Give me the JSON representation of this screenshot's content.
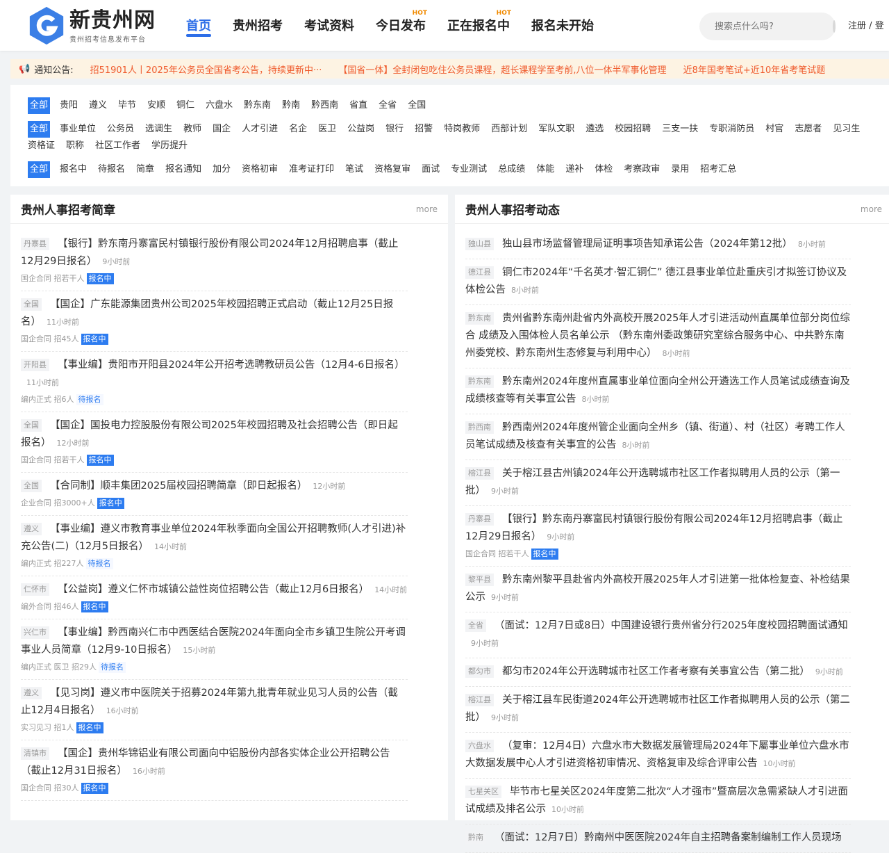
{
  "header": {
    "logo_name": "新贵州网",
    "logo_sub": "贵州招考信息发布平台",
    "nav": [
      {
        "label": "首页",
        "active": true
      },
      {
        "label": "贵州招考"
      },
      {
        "label": "考试资料"
      },
      {
        "label": "今日发布",
        "hot": "HOT"
      },
      {
        "label": "正在报名中",
        "hot": "HOT"
      },
      {
        "label": "报名未开始"
      }
    ],
    "search_placeholder": "搜索点什么吗?",
    "register": "注册",
    "separator": "/",
    "login": "登"
  },
  "notice": {
    "label": "通知公告:",
    "messages": [
      "招51901人丨2025年公务员全国省考公告，持续更新中···",
      "【国省一体】全封闭包吃住公务员课程，超长课程学至考前,八位一体半军事化管理",
      "近8年国考笔试+近10年省考笔试题"
    ]
  },
  "filters": [
    [
      "全部",
      "贵阳",
      "遵义",
      "毕节",
      "安顺",
      "铜仁",
      "六盘水",
      "黔东南",
      "黔南",
      "黔西南",
      "省直",
      "全省",
      "全国"
    ],
    [
      "全部",
      "事业单位",
      "公务员",
      "选调生",
      "教师",
      "国企",
      "人才引进",
      "名企",
      "医卫",
      "公益岗",
      "银行",
      "招警",
      "特岗教师",
      "西部计划",
      "军队文职",
      "遴选",
      "校园招聘",
      "三支一扶",
      "专职消防员",
      "村官",
      "志愿者",
      "见习生",
      "资格证",
      "职称",
      "社区工作者",
      "学历提升"
    ],
    [
      "全部",
      "报名中",
      "待报名",
      "简章",
      "报名通知",
      "加分",
      "资格初审",
      "准考证打印",
      "笔试",
      "资格复审",
      "面试",
      "专业测试",
      "总成绩",
      "体能",
      "递补",
      "体检",
      "考察政审",
      "录用",
      "招考汇总"
    ]
  ],
  "left": {
    "title": "贵州人事招考简章",
    "more": "more",
    "items": [
      {
        "tag": "丹寨县",
        "title": "【银行】黔东南丹寨富民村镇银行股份有限公司2024年12月招聘启事（截止12月29日报名）",
        "time": "9小时前",
        "meta": "国企合同 招若干人",
        "status": "报名中"
      },
      {
        "tag": "全国",
        "title": "【国企】广东能源集团贵州公司2025年校园招聘正式启动（截止12月25日报名）",
        "time": "11小时前",
        "meta": "国企合同 招45人",
        "status": "报名中"
      },
      {
        "tag": "开阳县",
        "title": "【事业编】贵阳市开阳县2024年公开招考选聘教研员公告（12月4-6日报名）",
        "time": "11小时前",
        "meta": "编内正式 招6人",
        "status": "待报名"
      },
      {
        "tag": "全国",
        "title": "【国企】国投电力控股股份有限公司2025年校园招聘及社会招聘公告（即日起报名）",
        "time": "12小时前",
        "meta": "国企合同 招若干人",
        "status": "报名中"
      },
      {
        "tag": "全国",
        "title": "【合同制】顺丰集团2025届校园招聘简章（即日起报名）",
        "time": "12小时前",
        "meta": "企业合同 招3000+人",
        "status": "报名中"
      },
      {
        "tag": "遵义",
        "title": "【事业编】遵义市教育事业单位2024年秋季面向全国公开招聘教师(人才引进)补充公告(二)（12月5日报名）",
        "time": "14小时前",
        "meta": "编内正式 招227人",
        "status": "待报名"
      },
      {
        "tag": "仁怀市",
        "title": "【公益岗】遵义仁怀市城镇公益性岗位招聘公告（截止12月6日报名）",
        "time": "14小时前",
        "meta": "编外合同 招46人",
        "status": "报名中"
      },
      {
        "tag": "兴仁市",
        "title": "【事业编】黔西南兴仁市中西医结合医院2024年面向全市乡镇卫生院公开考调事业人员简章（12月9-10日报名）",
        "time": "15小时前",
        "meta": "编内正式 医卫 招29人",
        "status": "待报名"
      },
      {
        "tag": "遵义",
        "title": "【见习岗】遵义市中医院关于招募2024年第九批青年就业见习人员的公告（截止12月4日报名）",
        "time": "16小时前",
        "meta": "实习见习 招1人",
        "status": "报名中"
      },
      {
        "tag": "清镇市",
        "title": "【国企】贵州华锦铝业有限公司面向中铝股份内部各实体企业公开招聘公告（截止12月31日报名）",
        "time": "16小时前",
        "meta": "国企合同 招30人",
        "status": "报名中"
      }
    ]
  },
  "right": {
    "title": "贵州人事招考动态",
    "more": "more",
    "items": [
      {
        "tag": "独山县",
        "title": "独山县市场监督管理局证明事项告知承诺公告（2024年第12批）",
        "time": "8小时前"
      },
      {
        "tag": "德江县",
        "title": "铜仁市2024年“千名英才·智汇铜仁” 德江县事业单位赴重庆引才拟签订协议及体检公告",
        "time": "8小时前"
      },
      {
        "tag": "黔东南",
        "title": "贵州省黔东南州赴省内外高校开展2025年人才引进活动州直属单位部分岗位综合 成绩及入围体检人员名单公示 （黔东南州委政策研究室综合服务中心、中共黔东南州委党校、黔东南州生态修复与利用中心）",
        "time": "8小时前"
      },
      {
        "tag": "黔东南",
        "title": "黔东南州2024年度州直属事业单位面向全州公开遴选工作人员笔试成绩查询及成绩核查等有关事宜公告",
        "time": "8小时前"
      },
      {
        "tag": "黔西南",
        "title": "黔西南州2024年度州管企业面向全州乡（镇、街道）、村（社区）考聘工作人员笔试成绩及核查有关事宜的公告",
        "time": "8小时前"
      },
      {
        "tag": "榕江县",
        "title": "关于榕江县古州镇2024年公开选聘城市社区工作者拟聘用人员的公示（第一批）",
        "time": "9小时前"
      },
      {
        "tag": "丹寨县",
        "title": "【银行】黔东南丹寨富民村镇银行股份有限公司2024年12月招聘启事（截止12月29日报名）",
        "time": "9小时前",
        "meta": "国企合同 招若干人",
        "status": "报名中"
      },
      {
        "tag": "黎平县",
        "title": "黔东南州黎平县赴省内外高校开展2025年人才引进第一批体检复查、补检结果公示",
        "time": "9小时前"
      },
      {
        "tag": "全省",
        "title": "（面试：12月7日或8日）中国建设银行贵州省分行2025年度校园招聘面试通知",
        "time": "9小时前"
      },
      {
        "tag": "都匀市",
        "title": "都匀市2024年公开选聘城市社区工作者考察有关事宜公告（第二批）",
        "time": "9小时前"
      },
      {
        "tag": "榕江县",
        "title": "关于榕江县车民街道2024年公开选聘城市社区工作者拟聘用人员的公示（第二批）",
        "time": "9小时前"
      },
      {
        "tag": "六盘水",
        "title": "（复审：12月4日）六盘水市大数据发展管理局2024年下屬事业单位六盘水市大数据发展中心人才引进资格初审情况、资格复审及综合评审公告",
        "time": "10小时前"
      },
      {
        "tag": "七星关区",
        "title": "毕节市七星关区2024年度第二批次“人才强市”暨高层次急需紧缺人才引进面试成绩及排名公示",
        "time": "10小时前"
      },
      {
        "tag": "黔南",
        "title": "（面试：12月7日）黔南州中医医院2024年自主招聘备案制编制工作人员现场",
        "time": ""
      }
    ]
  }
}
